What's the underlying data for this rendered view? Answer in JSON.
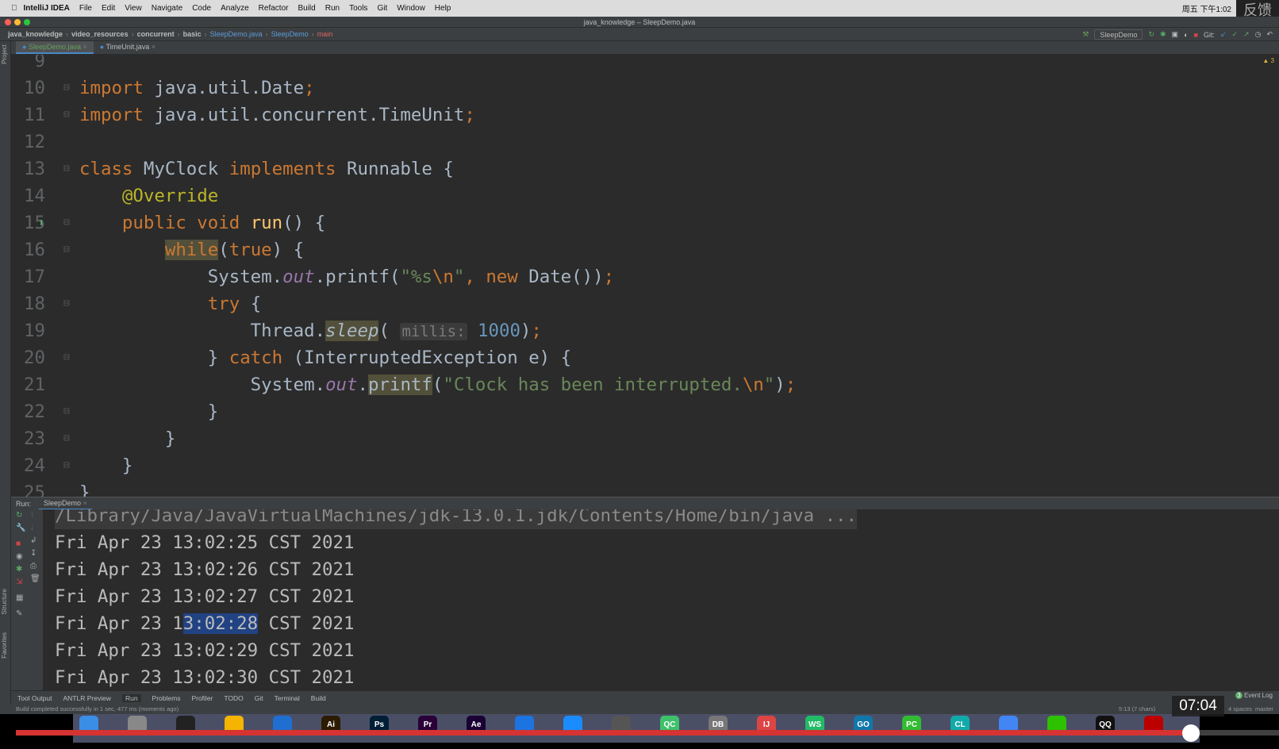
{
  "menubar": {
    "app": "IntelliJ IDEA",
    "items": [
      "File",
      "Edit",
      "View",
      "Navigate",
      "Code",
      "Analyze",
      "Refactor",
      "Build",
      "Run",
      "Tools",
      "Git",
      "Window",
      "Help"
    ],
    "clock": "周五 下午1:02",
    "overlay": "反馈"
  },
  "window_title": "java_knowledge – SleepDemo.java",
  "breadcrumb": [
    "java_knowledge",
    "video_resources",
    "concurrent",
    "basic",
    "SleepDemo.java",
    "SleepDemo",
    "main"
  ],
  "toolbar": {
    "run_config": "SleepDemo",
    "git_label": "Git:"
  },
  "tabs": [
    {
      "label": "SleepDemo.java",
      "active": true
    },
    {
      "label": "TimeUnit.java",
      "active": false
    }
  ],
  "left_strip": {
    "project": "Project",
    "structure": "Structure",
    "favorites": "Favorites"
  },
  "inspection_count": "3",
  "editor": {
    "lines": [
      {
        "n": "9",
        "tokens": []
      },
      {
        "n": "10",
        "tokens": [
          {
            "t": "import ",
            "c": "kw"
          },
          {
            "t": "java.util.Date"
          },
          {
            "t": ";",
            "c": "kw"
          }
        ]
      },
      {
        "n": "11",
        "tokens": [
          {
            "t": "import ",
            "c": "kw"
          },
          {
            "t": "java.util.concurrent.TimeUnit"
          },
          {
            "t": ";",
            "c": "kw"
          }
        ]
      },
      {
        "n": "12",
        "tokens": []
      },
      {
        "n": "13",
        "tokens": [
          {
            "t": "class ",
            "c": "kw"
          },
          {
            "t": "MyClock "
          },
          {
            "t": "implements ",
            "c": "kw"
          },
          {
            "t": "Runnable {"
          }
        ]
      },
      {
        "n": "14",
        "tokens": [
          {
            "t": "    "
          },
          {
            "t": "@Override",
            "c": "ann"
          }
        ]
      },
      {
        "n": "15",
        "tokens": [
          {
            "t": "    "
          },
          {
            "t": "public void ",
            "c": "kw"
          },
          {
            "t": "run",
            "c": "mth"
          },
          {
            "t": "() {"
          }
        ]
      },
      {
        "n": "16",
        "tokens": [
          {
            "t": "        "
          },
          {
            "t": "while",
            "c": "kw hl"
          },
          {
            "t": "("
          },
          {
            "t": "true",
            "c": "kw"
          },
          {
            "t": ") {"
          }
        ]
      },
      {
        "n": "17",
        "tokens": [
          {
            "t": "            System."
          },
          {
            "t": "out",
            "c": "fld"
          },
          {
            "t": ".printf("
          },
          {
            "t": "\"%s",
            "c": "str"
          },
          {
            "t": "\\n",
            "c": "kw"
          },
          {
            "t": "\"",
            "c": "str"
          },
          {
            "t": ", ",
            "c": "kw"
          },
          {
            "t": "new ",
            "c": "kw"
          },
          {
            "t": "Date())"
          },
          {
            "t": ";",
            "c": "kw"
          }
        ]
      },
      {
        "n": "18",
        "tokens": [
          {
            "t": "            "
          },
          {
            "t": "try ",
            "c": "kw"
          },
          {
            "t": "{"
          }
        ]
      },
      {
        "n": "19",
        "tokens": [
          {
            "t": "                Thread."
          },
          {
            "t": "sleep",
            "c": "it hl"
          },
          {
            "t": "( "
          },
          {
            "t": "millis:",
            "c": "hint"
          },
          {
            "t": " "
          },
          {
            "t": "1000",
            "c": "num"
          },
          {
            "t": ")"
          },
          {
            "t": ";",
            "c": "kw"
          }
        ]
      },
      {
        "n": "20",
        "tokens": [
          {
            "t": "            } "
          },
          {
            "t": "catch ",
            "c": "kw"
          },
          {
            "t": "(InterruptedException e) {"
          }
        ]
      },
      {
        "n": "21",
        "tokens": [
          {
            "t": "                System."
          },
          {
            "t": "out",
            "c": "fld"
          },
          {
            "t": "."
          },
          {
            "t": "printf",
            "c": "hl"
          },
          {
            "t": "("
          },
          {
            "t": "\"Clock has been interrupted.",
            "c": "str"
          },
          {
            "t": "\\n",
            "c": "kw"
          },
          {
            "t": "\"",
            "c": "str"
          },
          {
            "t": ")"
          },
          {
            "t": ";",
            "c": "kw"
          }
        ]
      },
      {
        "n": "22",
        "tokens": [
          {
            "t": "            }"
          }
        ]
      },
      {
        "n": "23",
        "tokens": [
          {
            "t": "        }"
          }
        ]
      },
      {
        "n": "24",
        "tokens": [
          {
            "t": "    }"
          }
        ]
      },
      {
        "n": "25",
        "tokens": [
          {
            "t": "}"
          }
        ]
      }
    ]
  },
  "run": {
    "label": "Run:",
    "tab": "SleepDemo",
    "path": "/Library/Java/JavaVirtualMachines/jdk-13.0.1.jdk/Contents/Home/bin/java ...",
    "output": [
      "Fri Apr 23 13:02:25 CST 2021",
      "Fri Apr 23 13:02:26 CST 2021",
      "Fri Apr 23 13:02:27 CST 2021",
      "Fri Apr 23 13:02:28 CST 2021",
      "Fri Apr 23 13:02:29 CST 2021",
      "Fri Apr 23 13:02:30 CST 2021"
    ],
    "selected_line": 3,
    "selected_text": "3:02:28"
  },
  "tool_windows": [
    "Tool Output",
    "ANTLR Preview",
    "Run",
    "Problems",
    "Profiler",
    "TODO",
    "Git",
    "Terminal",
    "Build"
  ],
  "status": {
    "message": "Build completed successfully in 1 sec, 477 ms (moments ago)",
    "position": "5:13 (7 chars)",
    "indent": "4 spaces",
    "branch": "master",
    "event_log": "Event Log",
    "event_count": "3"
  },
  "video": {
    "time": "07:04",
    "progress_percent": 93
  },
  "dock_apps": [
    "Finder",
    "Launchpad",
    "Terminal",
    "Notes",
    "VS Code",
    "Ai",
    "Ps",
    "Pr",
    "Ae",
    "Xcode",
    "Safari",
    "Sublime",
    "QC",
    "DB",
    "IJ",
    "WS",
    "GO",
    "PC",
    "CL",
    "Chrome",
    "WeChat",
    "QQ",
    "FileZilla"
  ]
}
